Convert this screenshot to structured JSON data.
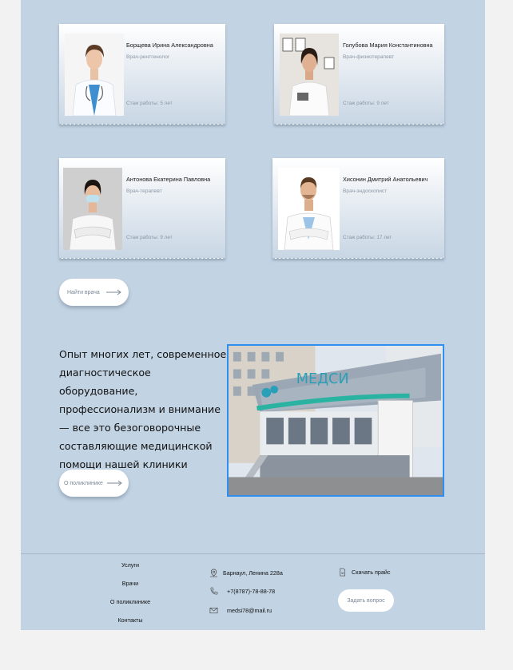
{
  "doctors": [
    {
      "name": "Борщева Ирина Александровна",
      "role": "Врач-рентгенолог",
      "experience": "Стаж работы: 5 лет"
    },
    {
      "name": "Голубова Мария Константиновна",
      "role": "Врач-физиотерапевт",
      "experience": "Стаж работы: 9 лет"
    },
    {
      "name": "Антонова Екатерина Павловна",
      "role": "Врач-терапевт",
      "experience": "Стаж работы: 9 лет"
    },
    {
      "name": "Хисонин Дмитрий Анатольевич",
      "role": "Врач-эндоскопист",
      "experience": "Стаж работы: 17 лет"
    }
  ],
  "find_doctor_button": "Найти врача",
  "about": {
    "text": "Опыт многих лет, современное диагностическое оборудование, профессионализм и внимание — все это безоговорочные составляющие медицинской помощи нашей клиники",
    "button": "О поликлинике"
  },
  "clinic_sign": {
    "brand": "МЕДСИ"
  },
  "footer": {
    "nav": [
      "Услуги",
      "Врачи",
      "О поликлинике",
      "Контакты"
    ],
    "address": "Барнаул, Ленина 228а",
    "phone": "+7(8787)-78-88-78",
    "email": "medsi78@mail.ru",
    "download_price": "Скачать прайс",
    "ask_question": "Задать вопрос"
  },
  "icons": {
    "address": "map-pin-icon",
    "phone": "phone-icon",
    "email": "mail-icon",
    "download": "document-icon"
  }
}
